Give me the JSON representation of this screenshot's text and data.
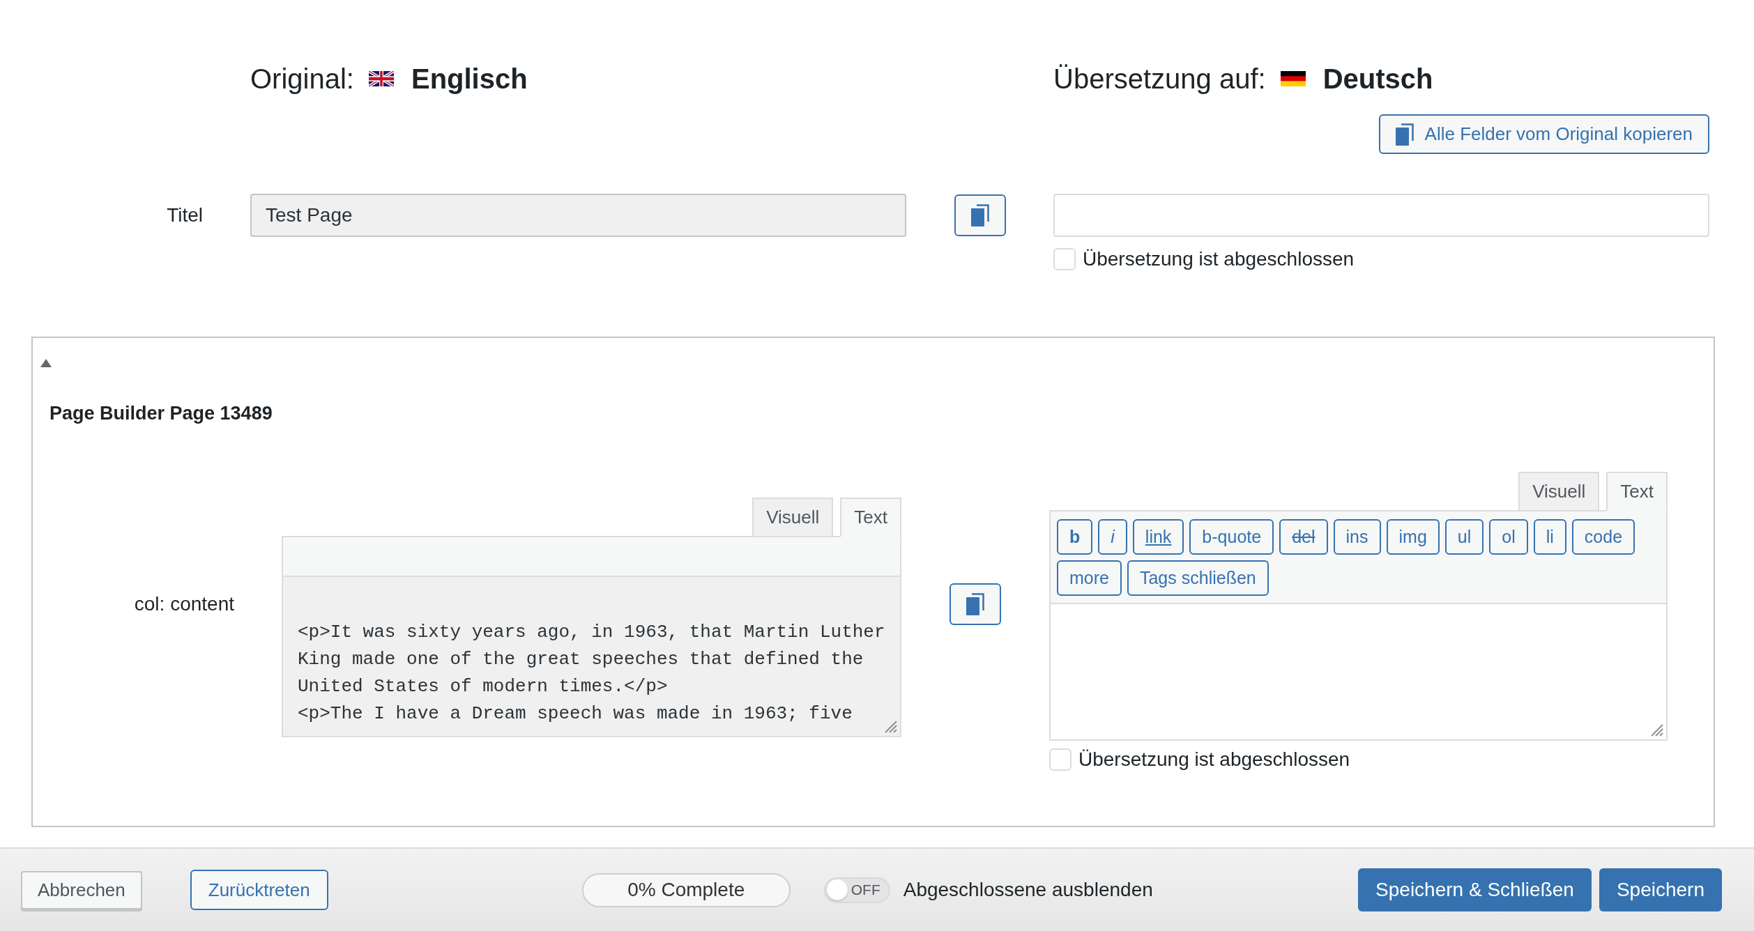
{
  "header": {
    "original": {
      "label": "Original:",
      "language": "Englisch"
    },
    "translation": {
      "label": "Übersetzung auf:",
      "language": "Deutsch"
    }
  },
  "copy_all_button": {
    "label": "Alle Felder vom Original kopieren"
  },
  "title_row": {
    "label": "Titel",
    "original_value": "Test Page",
    "complete": {
      "label": "Übersetzung ist abgeschlossen",
      "checked": false
    }
  },
  "section": {
    "title": "Page Builder Page 13489",
    "expanded": true,
    "fields": [
      {
        "label": "col: content",
        "original": {
          "tabs": [
            {
              "label": "Visuell",
              "selected": false
            },
            {
              "label": "Text",
              "selected": true
            }
          ],
          "value": "<p>It was sixty years ago, in 1963, that Martin Luther King made one of the great speeches that defined the United States of modern times.</p>\n<p>The I have a Dream speech was made in 1963; five"
        },
        "translation": {
          "tabs": [
            {
              "label": "Visuell",
              "selected": false
            },
            {
              "label": "Text",
              "selected": true
            }
          ],
          "toolbar": [
            {
              "label": "b",
              "kind": "bold"
            },
            {
              "label": "i",
              "kind": "italic"
            },
            {
              "label": "link",
              "kind": "link"
            },
            {
              "label": "b-quote",
              "kind": "plain"
            },
            {
              "label": "del",
              "kind": "strike"
            },
            {
              "label": "ins",
              "kind": "plain"
            },
            {
              "label": "img",
              "kind": "plain"
            },
            {
              "label": "ul",
              "kind": "plain"
            },
            {
              "label": "ol",
              "kind": "plain"
            },
            {
              "label": "li",
              "kind": "plain"
            },
            {
              "label": "code",
              "kind": "plain"
            },
            {
              "label": "more",
              "kind": "plain"
            },
            {
              "label": "Tags schließen",
              "kind": "plain"
            }
          ],
          "complete": {
            "label": "Übersetzung ist abgeschlossen",
            "checked": false
          }
        }
      }
    ]
  },
  "footer": {
    "cancel": "Abbrechen",
    "resign": "Zurücktreten",
    "progress": {
      "label": "0% Complete"
    },
    "hide_completed": {
      "label": "Abgeschlossene ausblenden",
      "switch_text": "OFF",
      "on": false
    },
    "save_close": "Speichern & Schließen",
    "save": "Speichern"
  }
}
